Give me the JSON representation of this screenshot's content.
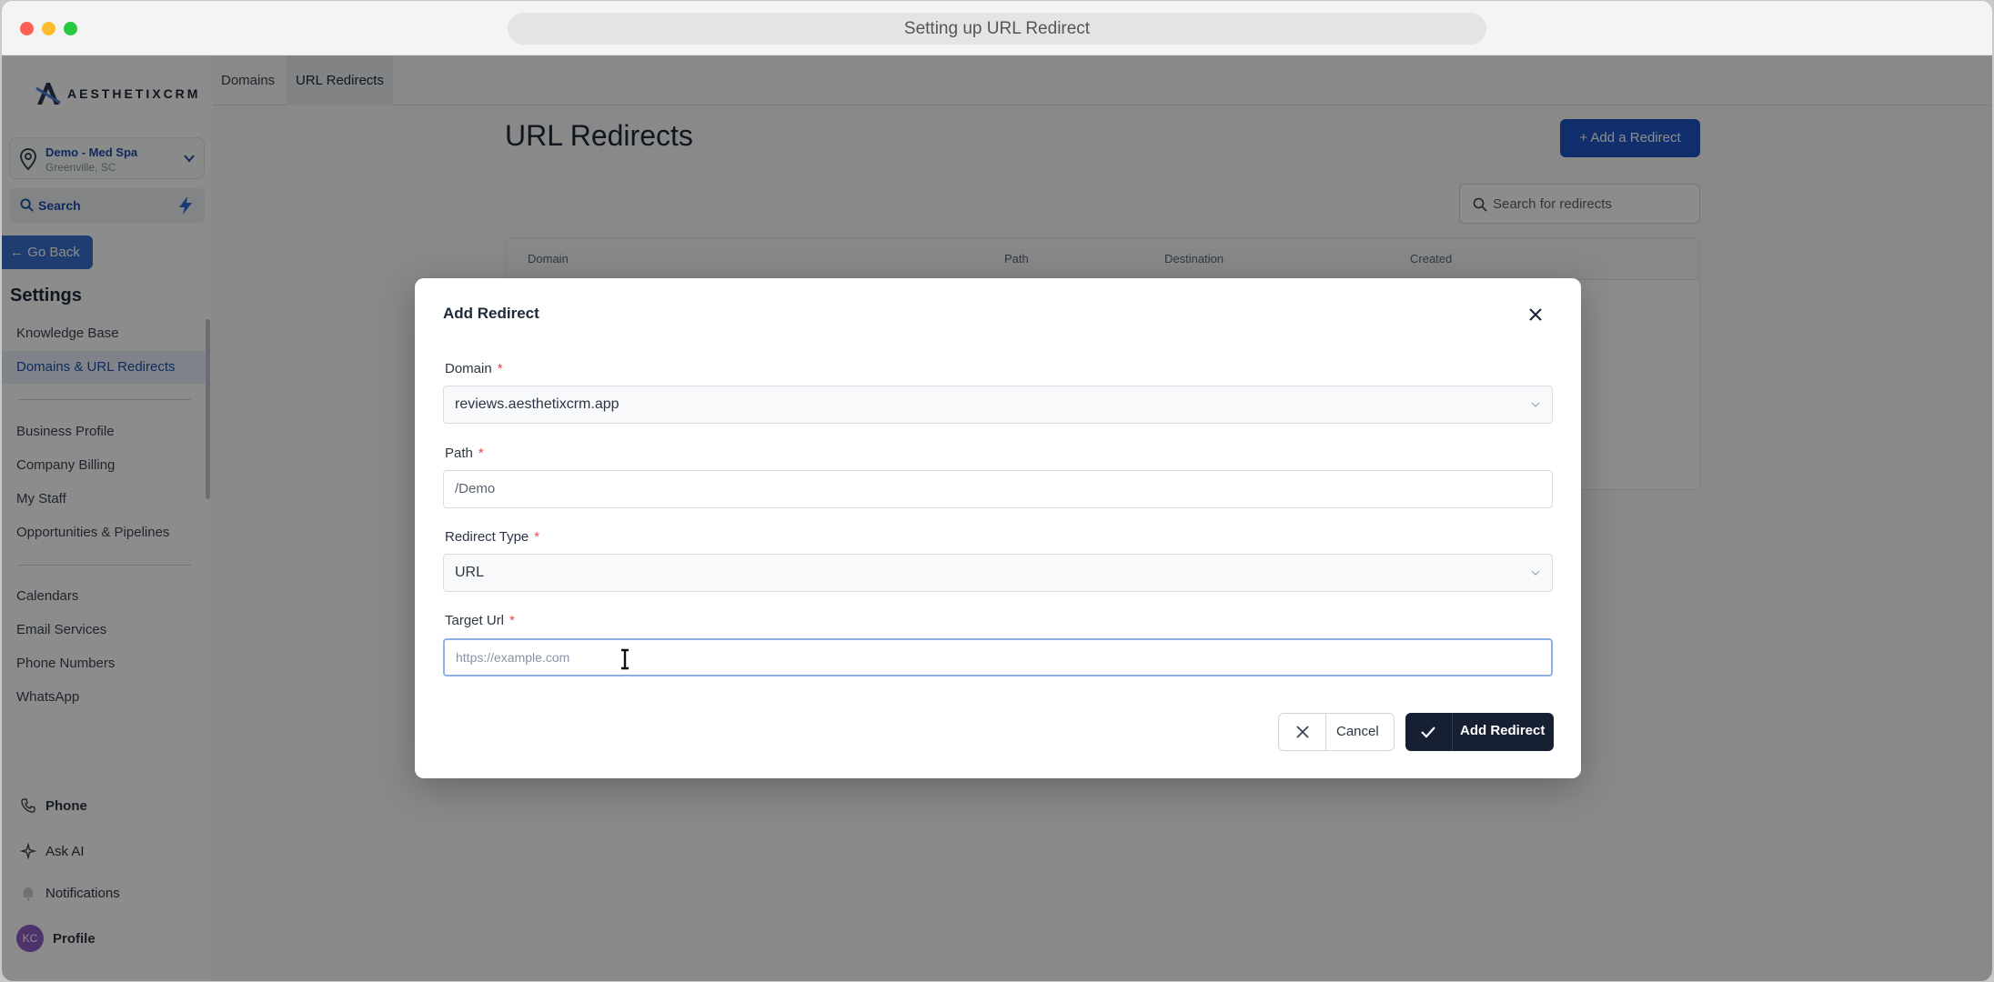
{
  "window": {
    "title": "Setting up URL Redirect"
  },
  "sidebar": {
    "logo_text": "AESTHETIXCRM",
    "location": {
      "name": "Demo - Med Spa",
      "city": "Greenville, SC"
    },
    "search_label": "Search",
    "go_back": "← Go Back",
    "settings_heading": "Settings",
    "items": [
      {
        "label": "Knowledge Base"
      },
      {
        "label": "Domains & URL Redirects",
        "active": true
      },
      {
        "label": "Business Profile"
      },
      {
        "label": "Company Billing"
      },
      {
        "label": "My Staff"
      },
      {
        "label": "Opportunities & Pipelines"
      },
      {
        "label": "Calendars"
      },
      {
        "label": "Email Services"
      },
      {
        "label": "Phone Numbers"
      },
      {
        "label": "WhatsApp"
      }
    ],
    "bottom": {
      "phone": "Phone",
      "ask_ai": "Ask AI",
      "notifications": "Notifications",
      "avatar_initials": "KC",
      "profile": "Profile"
    }
  },
  "main": {
    "tabs": [
      {
        "label": "Domains"
      },
      {
        "label": "URL Redirects",
        "active": true
      }
    ],
    "title": "URL Redirects",
    "add_button": "+ Add a Redirect",
    "search_placeholder": "Search for redirects",
    "table": {
      "columns": [
        "Domain",
        "Path",
        "Destination",
        "Created"
      ]
    }
  },
  "modal": {
    "title": "Add Redirect",
    "fields": {
      "domain": {
        "label": "Domain",
        "required": "*",
        "value": "reviews.aesthetixcrm.app"
      },
      "path": {
        "label": "Path",
        "required": "*",
        "value": "/Demo"
      },
      "redirect_type": {
        "label": "Redirect Type",
        "required": "*",
        "value": "URL"
      },
      "target_url": {
        "label": "Target Url",
        "required": "*",
        "value": "",
        "placeholder": "https://example.com"
      }
    },
    "cancel_label": "Cancel",
    "submit_label": "Add Redirect"
  },
  "colors": {
    "primary": "#1f56c7",
    "dark_button": "#172033",
    "required": "#e5484d",
    "focus_border": "#8fb0e6"
  }
}
